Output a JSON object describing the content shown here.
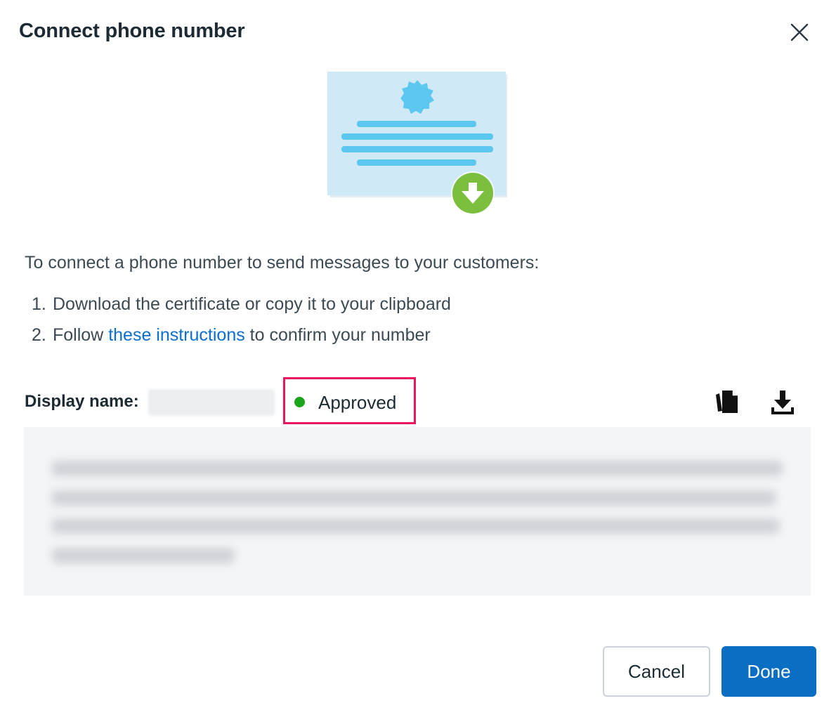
{
  "dialog": {
    "title": "Connect phone number",
    "intro": "To connect a phone number to send messages to your customers:",
    "steps": [
      {
        "num": "1.",
        "text": "Download the certificate or copy it to your clipboard"
      },
      {
        "num": "2.",
        "before": "Follow ",
        "link": "these instructions",
        "after": " to confirm your number"
      }
    ],
    "display_name_label": "Display name:",
    "status": {
      "label": "Approved",
      "color": "#1aa51a"
    },
    "icons": {
      "close": "close-icon",
      "copy": "copy-icon",
      "download": "download-icon",
      "illustration": "certificate-download-illustration"
    },
    "buttons": {
      "cancel": "Cancel",
      "done": "Done"
    },
    "colors": {
      "accent": "#0a6fc2",
      "link": "#0a6fd1",
      "highlight": "#e8175d"
    }
  }
}
